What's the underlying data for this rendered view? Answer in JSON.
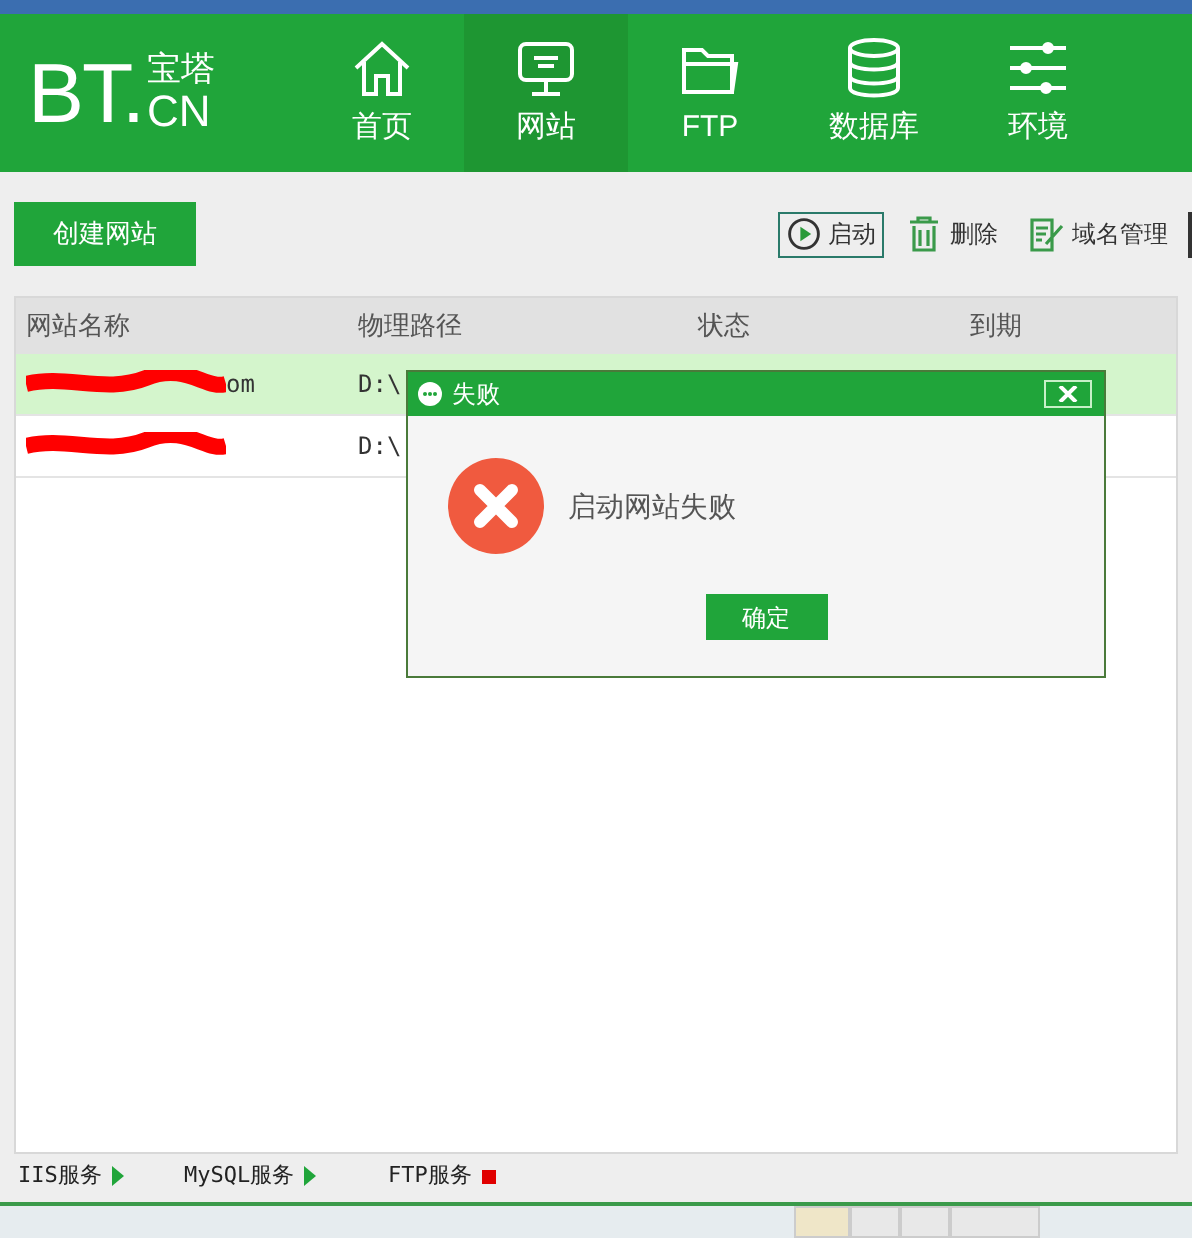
{
  "logo": {
    "main": "BT.",
    "top": "宝塔",
    "bottom": "CN"
  },
  "nav": [
    {
      "label": "首页",
      "selected": false
    },
    {
      "label": "网站",
      "selected": true
    },
    {
      "label": "FTP",
      "selected": false
    },
    {
      "label": "数据库",
      "selected": false
    },
    {
      "label": "环境",
      "selected": false
    }
  ],
  "toolbar": {
    "create_button": "创建网站",
    "actions": [
      {
        "label": "启动",
        "selected": true
      },
      {
        "label": "删除",
        "selected": false
      },
      {
        "label": "域名管理",
        "selected": false
      }
    ]
  },
  "table": {
    "columns": [
      "网站名称",
      "物理路径",
      "状态",
      "到期"
    ],
    "rows": [
      {
        "name": "om",
        "path": "D:\\",
        "selected": true
      },
      {
        "path": "D:\\",
        "selected": false
      }
    ]
  },
  "dialog": {
    "title": "失败",
    "message": "启动网站失败",
    "ok_button": "确定"
  },
  "status_bar": [
    {
      "label": "IIS服务",
      "running": true
    },
    {
      "label": "MySQL服务",
      "running": true
    },
    {
      "label": "FTP服务",
      "running": false
    }
  ]
}
